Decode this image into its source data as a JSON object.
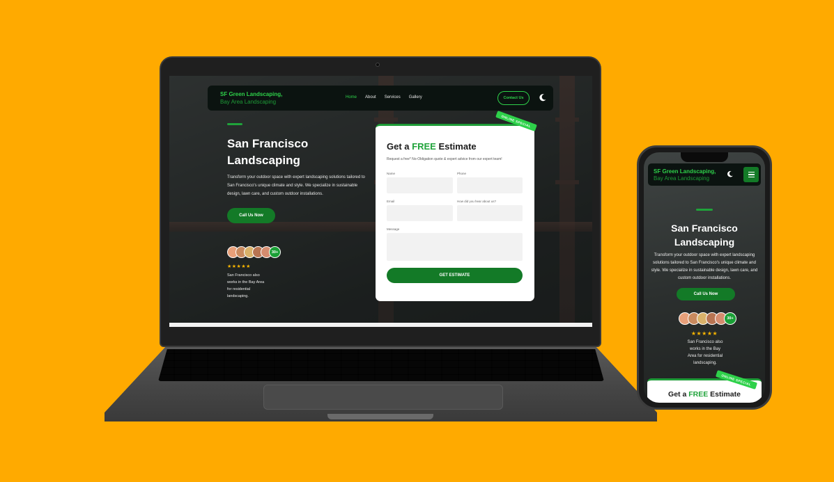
{
  "colors": {
    "background": "#FFAA00",
    "brand_green": "#1fa33a",
    "button_green": "#137a27",
    "accent_green": "#2ed14a",
    "star_gold": "#f7b500"
  },
  "site": {
    "brand_line1": "SF Green Landscaping,",
    "brand_line2": "Bay Area Landscaping",
    "nav": [
      {
        "label": "Home",
        "active": true
      },
      {
        "label": "About",
        "active": false
      },
      {
        "label": "Services",
        "active": false
      },
      {
        "label": "Gallery",
        "active": false
      }
    ],
    "contact_button": "Contact Us",
    "theme_toggle_icon": "moon-icon",
    "menu_icon": "hamburger-icon"
  },
  "hero": {
    "title": "San Francisco Landscaping",
    "description": "Transform your outdoor space with expert landscaping solutions tailored to San Francisco's unique climate and style. We specialize in sustainable design, lawn care, and custom outdoor installations.",
    "call_button": "Call Us Now",
    "customer_badge": "30+",
    "stars": "★★★★★",
    "social_proof": "San Francisco also works in the Bay Area for residential landscaping."
  },
  "estimate_form": {
    "ribbon": "ONLINE SPECIAL",
    "title_prefix": "Get a",
    "title_highlight": "FREE",
    "title_suffix": "Estimate",
    "subtitle": "Request a free* No-Obligation quote & expert advice from our expert team!",
    "fields": {
      "name_label": "Name",
      "phone_label": "Phone",
      "email_label": "Email",
      "referral_label": "How did you hear about us?",
      "message_label": "Message"
    },
    "submit_button": "GET ESTIMATE"
  }
}
